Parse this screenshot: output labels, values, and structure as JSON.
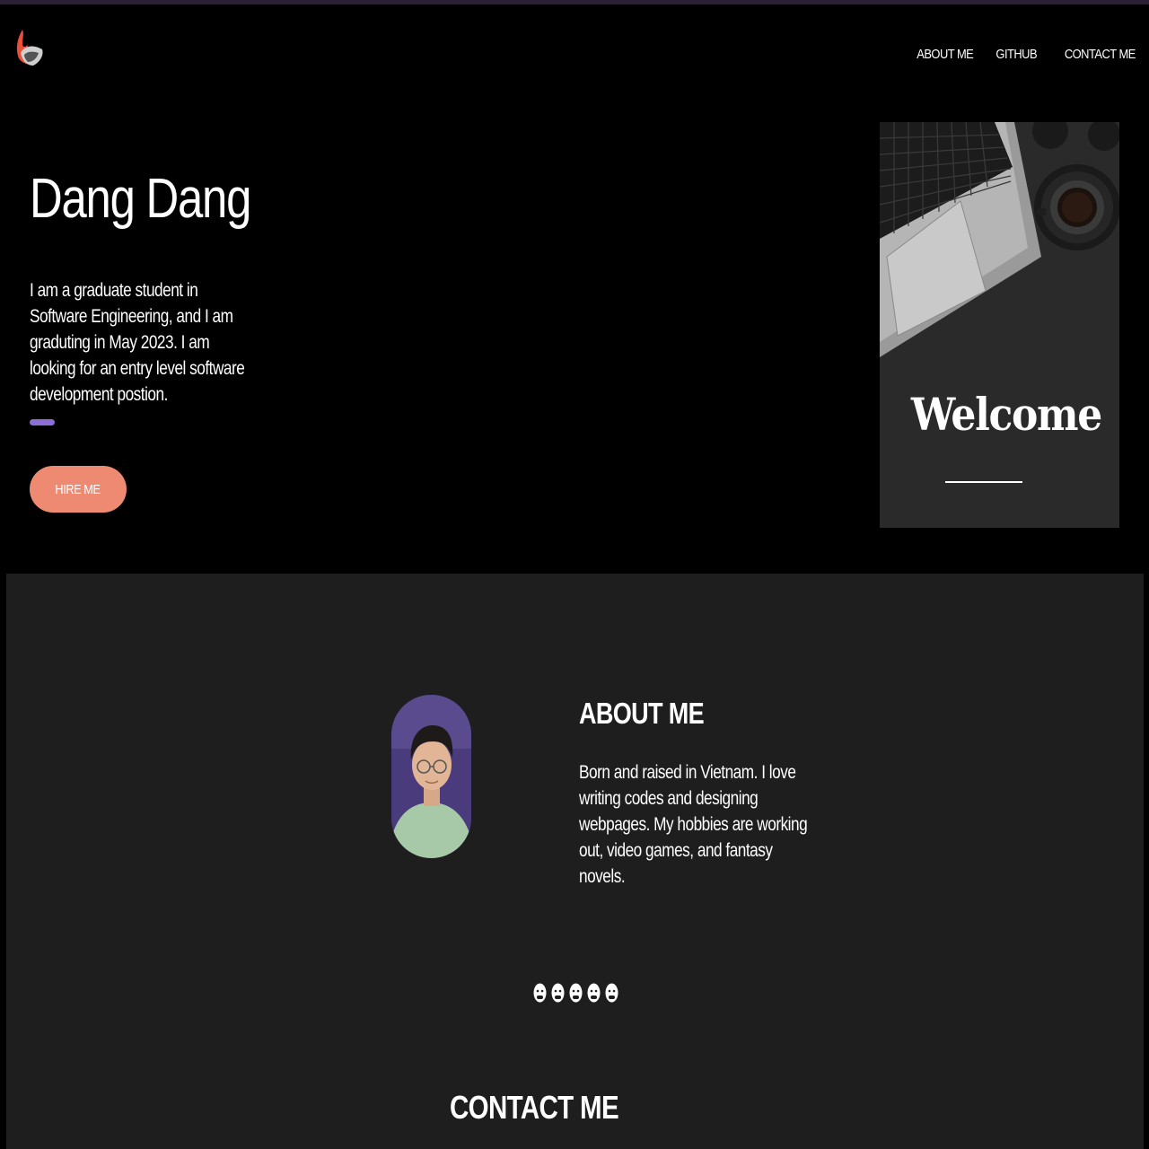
{
  "nav": {
    "items": [
      {
        "label": "ABOUT ME"
      },
      {
        "label": "GITHUB"
      },
      {
        "label": "CONTACT ME"
      }
    ]
  },
  "hero": {
    "name": "Dang Dang",
    "bio": "I am a graduate student in Software Engineering, and I am gradu­ting in May 2023. I am looking for an entry level software development postion.",
    "hire_button": "HIRE ME"
  },
  "welcome_card": {
    "title": "Welcome"
  },
  "about": {
    "title": "ABOUT ME",
    "text": "Born and raised in Vietnam. I love writing codes and designing webpages. My hobbies are working out, video games, and fantasy novels."
  },
  "social_icons": [
    "person-icon",
    "person-icon",
    "person-icon",
    "person-icon",
    "person-icon"
  ],
  "contact": {
    "title": "CONTACT ME"
  },
  "colors": {
    "accent": "#8b6fd6",
    "button": "#ee8a72",
    "section_bg": "#1e1e1e",
    "page_bg": "#000000"
  }
}
